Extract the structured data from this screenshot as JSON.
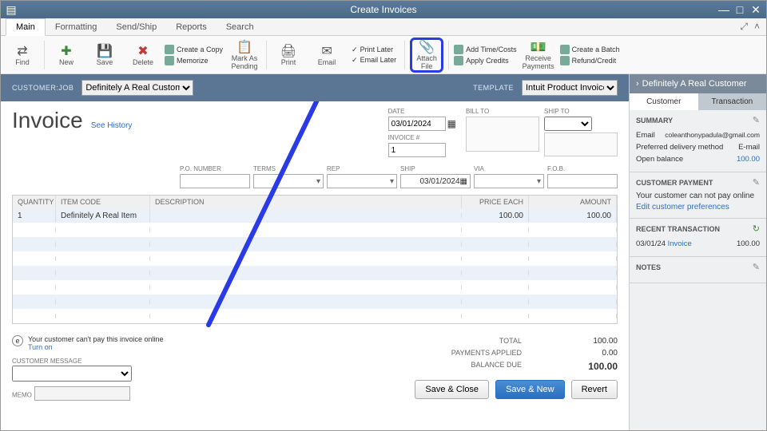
{
  "window": {
    "title": "Create Invoices"
  },
  "tabs": {
    "main": "Main",
    "formatting": "Formatting",
    "sendship": "Send/Ship",
    "reports": "Reports",
    "search": "Search"
  },
  "toolbar": {
    "find": "Find",
    "new": "New",
    "save": "Save",
    "delete": "Delete",
    "create_copy": "Create a Copy",
    "memorize": "Memorize",
    "mark_pending": "Mark As Pending",
    "print": "Print",
    "email": "Email",
    "print_later": "Print Later",
    "email_later": "Email Later",
    "attach_file": "Attach File",
    "add_time": "Add Time/Costs",
    "apply_credits": "Apply Credits",
    "receive_payments": "Receive Payments",
    "create_batch": "Create a Batch",
    "refund_credit": "Refund/Credit"
  },
  "bluebar": {
    "customer_label": "CUSTOMER:JOB",
    "customer_value": "Definitely A Real Customer",
    "template_label": "TEMPLATE",
    "template_value": "Intuit Product Invoice"
  },
  "invoice": {
    "title": "Invoice",
    "see_history": "See History",
    "date_label": "DATE",
    "date_value": "03/01/2024",
    "invoice_no_label": "INVOICE #",
    "invoice_no_value": "1",
    "bill_to_label": "BILL TO",
    "ship_to_label": "SHIP TO",
    "po_label": "P.O. NUMBER",
    "terms_label": "TERMS",
    "rep_label": "REP",
    "ship_label": "SHIP",
    "ship_value": "03/01/2024",
    "via_label": "VIA",
    "fob_label": "F.O.B."
  },
  "grid": {
    "headers": {
      "qty": "QUANTITY",
      "item": "ITEM CODE",
      "desc": "DESCRIPTION",
      "pe": "PRICE EACH",
      "amt": "AMOUNT"
    },
    "rows": [
      {
        "qty": "1",
        "item": "Definitely A Real Item",
        "desc": "",
        "pe": "100.00",
        "amt": "100.00"
      }
    ]
  },
  "footer": {
    "pay_online_text": "Your customer can't pay this invoice online",
    "turn_on": "Turn on",
    "cust_msg_label": "CUSTOMER MESSAGE",
    "memo_label": "MEMO",
    "total_label": "TOTAL",
    "total_value": "100.00",
    "payments_label": "PAYMENTS APPLIED",
    "payments_value": "0.00",
    "balance_label": "BALANCE DUE",
    "balance_value": "100.00",
    "save_close": "Save & Close",
    "save_new": "Save & New",
    "revert": "Revert"
  },
  "side": {
    "customer_name": "Definitely A Real Customer",
    "tab_customer": "Customer",
    "tab_transaction": "Transaction",
    "summary_h": "SUMMARY",
    "email_label": "Email",
    "email_value": "coleanthonypadula@gmail.com",
    "pdm_label": "Preferred delivery method",
    "pdm_value": "E-mail",
    "open_bal_label": "Open balance",
    "open_bal_value": "100.00",
    "cust_pay_h": "CUSTOMER PAYMENT",
    "cust_pay_text": "Your customer can not pay online",
    "cust_pay_link": "Edit customer preferences",
    "recent_h": "RECENT TRANSACTION",
    "recent_date": "03/01/24",
    "recent_type": "Invoice",
    "recent_amt": "100.00",
    "notes_h": "NOTES"
  }
}
